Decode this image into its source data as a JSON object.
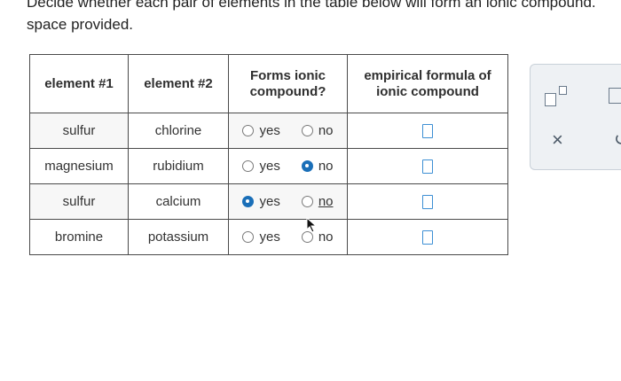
{
  "instructions": {
    "line1": "Decide whether each pair of elements in the table below will form an ionic compound.",
    "line2": "space provided."
  },
  "table": {
    "headers": [
      "element #1",
      "element #2",
      "Forms ionic compound?",
      "empirical formula of ionic compound"
    ],
    "rows": [
      {
        "element1": "sulfur",
        "element2": "chlorine",
        "yes_label": "yes",
        "no_label": "no",
        "selected": "none"
      },
      {
        "element1": "magnesium",
        "element2": "rubidium",
        "yes_label": "yes",
        "no_label": "no",
        "selected": "no"
      },
      {
        "element1": "sulfur",
        "element2": "calcium",
        "yes_label": "yes",
        "no_label": "no",
        "selected": "yes"
      },
      {
        "element1": "bromine",
        "element2": "potassium",
        "yes_label": "yes",
        "no_label": "no",
        "selected": "none"
      }
    ]
  },
  "tools": {
    "clear_symbol": "×",
    "undo_symbol": "↺",
    "superscript_icon": "superscript-icon",
    "box_icon": "box-icon"
  },
  "colors": {
    "radio_selected": "#1a6fb8",
    "answer_box_border": "#3d8fd4",
    "panel_bg": "#eef1f4"
  }
}
